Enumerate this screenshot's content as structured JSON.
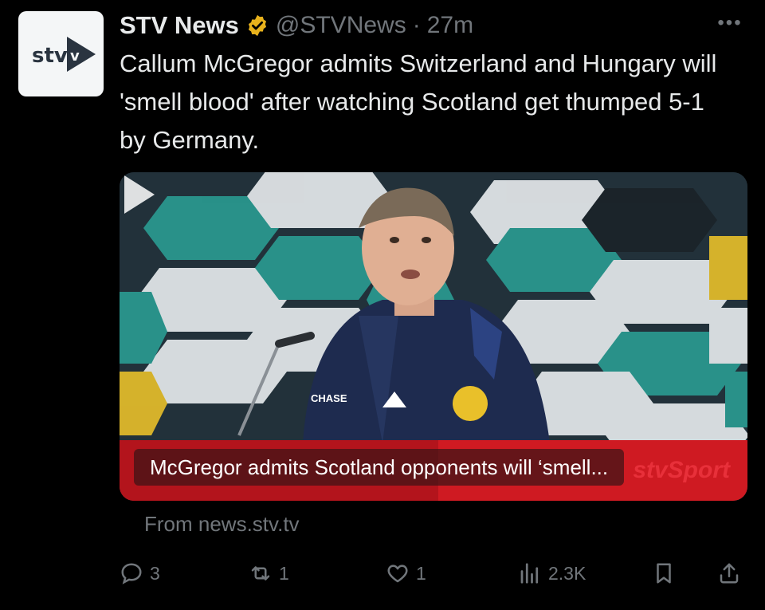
{
  "account": {
    "display_name": "STV News",
    "handle": "@STVNews",
    "separator": "·",
    "time": "27m",
    "avatar_label": "stv",
    "verified_icon": "verified-badge-icon"
  },
  "more_menu": {
    "label": "•••"
  },
  "tweet": {
    "text": "Callum McGregor admits Switzerland and Hungary will 'smell blood' after watching Scotland get thumped 5-1 by Germany."
  },
  "card": {
    "caption": "McGregor admits Scotland opponents will ‘smell...",
    "brand": "stvSport",
    "from": "From news.stv.tv",
    "colors": {
      "bar": "#cf1a22",
      "brand": "#e8303a"
    }
  },
  "actions": {
    "replies": "3",
    "reposts": "1",
    "likes": "1",
    "views": "2.3K"
  },
  "colors": {
    "text": "#e7e9ea",
    "muted": "#71767b",
    "verified": "#e8b21c"
  }
}
